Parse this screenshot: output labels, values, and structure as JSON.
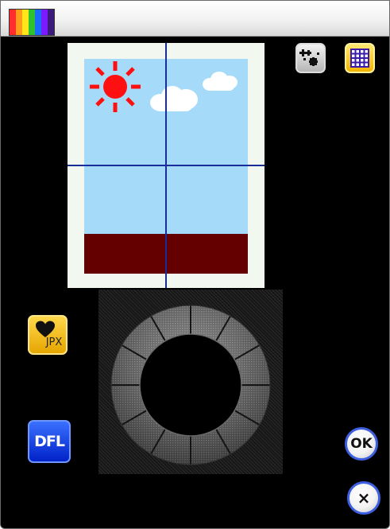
{
  "app_icon_colors": [
    "#ff2d2d",
    "#ff9c1a",
    "#ffe61a",
    "#2fc22f",
    "#1a6bff",
    "#7a1aff",
    "#3a1a7a"
  ],
  "tools": {
    "effects_icon": "effects-icon",
    "grid_icon": "grid-icon"
  },
  "side_buttons": {
    "jpx_label": "JPX",
    "dfl_label": "DFL"
  },
  "dialog_buttons": {
    "ok_label": "OK",
    "cancel_symbol": "×"
  },
  "colors": {
    "sky": "#a5daf8",
    "ground": "#650000",
    "sun": "#ff1010",
    "grid_lines": "#1a2e9a",
    "accent_blue": "#3d5fe0",
    "accent_yellow": "#f2b400"
  }
}
